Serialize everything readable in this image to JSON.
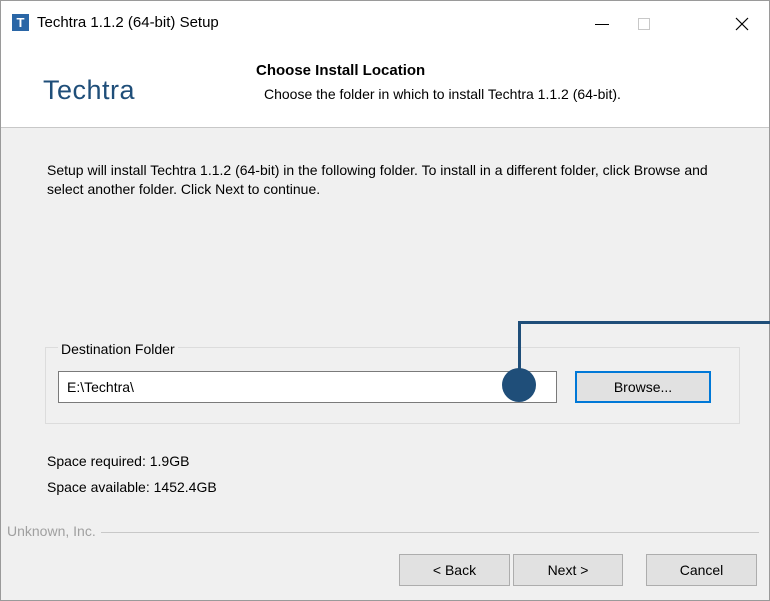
{
  "window": {
    "title": "Techtra 1.1.2 (64-bit) Setup",
    "icon_letter": "T"
  },
  "header": {
    "brand": "Techtra",
    "title": "Choose Install Location",
    "subtitle": "Choose the folder in which to install Techtra 1.1.2 (64-bit)."
  },
  "body": {
    "intro": "Setup will install Techtra 1.1.2 (64-bit) in the following folder. To install in a different folder, click Browse and select another folder. Click Next to continue.",
    "destination_label": "Destination Folder",
    "destination_value": "E:\\Techtra\\",
    "browse_label": "Browse...",
    "space_required": "Space required: 1.9GB",
    "space_available": "Space available: 1452.4GB"
  },
  "footer": {
    "vendor": "Unknown, Inc.",
    "back_label": "< Back",
    "next_label": "Next >",
    "cancel_label": "Cancel"
  },
  "colors": {
    "brand": "#1f4e79",
    "focus_border": "#0078d7",
    "marker": "#1f4e79"
  }
}
